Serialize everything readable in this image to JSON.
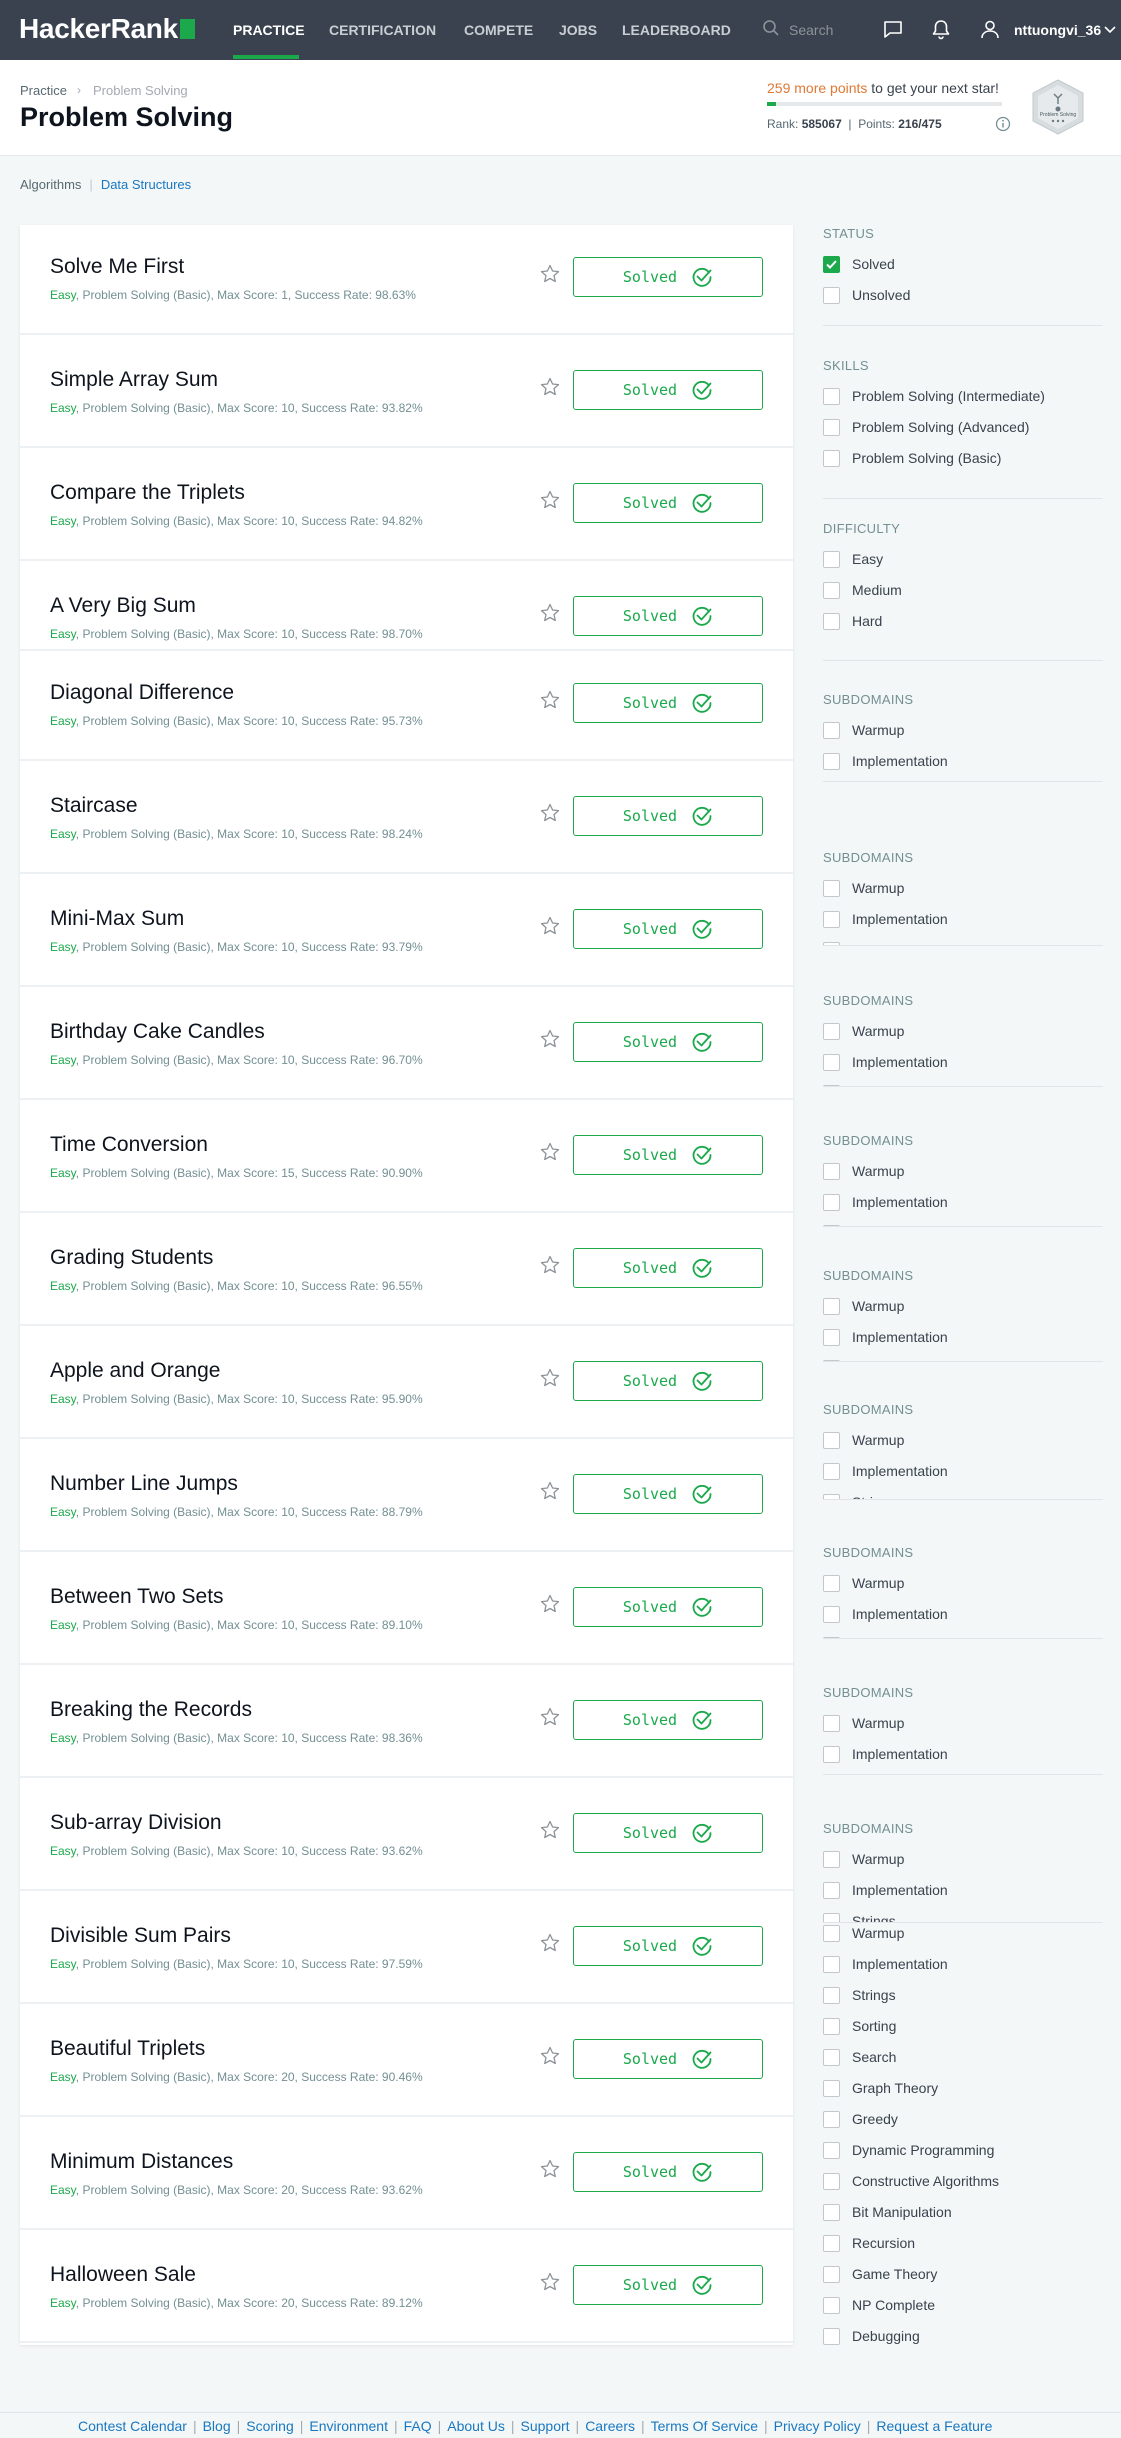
{
  "nav": {
    "logo": "HackerRank",
    "links": [
      "PRACTICE",
      "CERTIFICATION",
      "COMPETE",
      "JOBS",
      "LEADERBOARD"
    ],
    "search_placeholder": "Search",
    "username": "nttuongvi_36"
  },
  "header": {
    "breadcrumb": [
      "Practice",
      "Problem Solving"
    ],
    "title": "Problem Solving",
    "points_highlight": "259 more points",
    "points_rest": " to get your next star!",
    "progress": 0.04,
    "rank_label": "Rank:",
    "rank_value": "585067",
    "points_label": "Points:",
    "points_value": "216/475",
    "badge_label": "Problem Solving"
  },
  "subnav": {
    "items": [
      "Algorithms",
      "Data Structures"
    ]
  },
  "challenges": [
    {
      "title": "Solve Me First",
      "difficulty": "Easy",
      "meta": ", Problem Solving (Basic), Max Score: 1, Success Rate: 98.63%",
      "status": "Solved"
    },
    {
      "title": "Simple Array Sum",
      "difficulty": "Easy",
      "meta": ", Problem Solving (Basic), Max Score: 10, Success Rate: 93.82%",
      "status": "Solved"
    },
    {
      "title": "Compare the Triplets",
      "difficulty": "Easy",
      "meta": ", Problem Solving (Basic), Max Score: 10, Success Rate: 94.82%",
      "status": "Solved"
    },
    {
      "title": "A Very Big Sum",
      "difficulty": "Easy",
      "meta": ", Problem Solving (Basic), Max Score: 10, Success Rate: 98.70%",
      "status": "Solved"
    },
    {
      "title": "Diagonal Difference",
      "difficulty": "Easy",
      "meta": ", Problem Solving (Basic), Max Score: 10, Success Rate: 95.73%",
      "status": "Solved"
    },
    {
      "title": "Staircase",
      "difficulty": "Easy",
      "meta": ", Problem Solving (Basic), Max Score: 10, Success Rate: 98.24%",
      "status": "Solved"
    },
    {
      "title": "Mini-Max Sum",
      "difficulty": "Easy",
      "meta": ", Problem Solving (Basic), Max Score: 10, Success Rate: 93.79%",
      "status": "Solved"
    },
    {
      "title": "Birthday Cake Candles",
      "difficulty": "Easy",
      "meta": ", Problem Solving (Basic), Max Score: 10, Success Rate: 96.70%",
      "status": "Solved"
    },
    {
      "title": "Time Conversion",
      "difficulty": "Easy",
      "meta": ", Problem Solving (Basic), Max Score: 15, Success Rate: 90.90%",
      "status": "Solved"
    },
    {
      "title": "Grading Students",
      "difficulty": "Easy",
      "meta": ", Problem Solving (Basic), Max Score: 10, Success Rate: 96.55%",
      "status": "Solved"
    },
    {
      "title": "Apple and Orange",
      "difficulty": "Easy",
      "meta": ", Problem Solving (Basic), Max Score: 10, Success Rate: 95.90%",
      "status": "Solved"
    },
    {
      "title": "Number Line Jumps",
      "difficulty": "Easy",
      "meta": ", Problem Solving (Basic), Max Score: 10, Success Rate: 88.79%",
      "status": "Solved"
    },
    {
      "title": "Between Two Sets",
      "difficulty": "Easy",
      "meta": ", Problem Solving (Basic), Max Score: 10, Success Rate: 89.10%",
      "status": "Solved"
    },
    {
      "title": "Breaking the Records",
      "difficulty": "Easy",
      "meta": ", Problem Solving (Basic), Max Score: 10, Success Rate: 98.36%",
      "status": "Solved"
    },
    {
      "title": "Sub-array Division",
      "difficulty": "Easy",
      "meta": ", Problem Solving (Basic), Max Score: 10, Success Rate: 93.62%",
      "status": "Solved"
    },
    {
      "title": "Divisible Sum Pairs",
      "difficulty": "Easy",
      "meta": ", Problem Solving (Basic), Max Score: 10, Success Rate: 97.59%",
      "status": "Solved"
    },
    {
      "title": "Beautiful Triplets",
      "difficulty": "Easy",
      "meta": ", Problem Solving (Basic), Max Score: 20, Success Rate: 90.46%",
      "status": "Solved"
    },
    {
      "title": "Minimum Distances",
      "difficulty": "Easy",
      "meta": ", Problem Solving (Basic), Max Score: 20, Success Rate: 93.62%",
      "status": "Solved"
    },
    {
      "title": "Halloween Sale",
      "difficulty": "Easy",
      "meta": ", Problem Solving (Basic), Max Score: 20, Success Rate: 89.12%",
      "status": "Solved"
    }
  ],
  "filters": {
    "status": {
      "heading": "STATUS",
      "items": [
        "Solved",
        "Unsolved"
      ],
      "checked": [
        true,
        false
      ]
    },
    "skills": {
      "heading": "SKILLS",
      "items": [
        "Problem Solving (Intermediate)",
        "Problem Solving (Advanced)",
        "Problem Solving (Basic)"
      ]
    },
    "difficulty": {
      "heading": "DIFFICULTY",
      "items": [
        "Easy",
        "Medium",
        "Hard"
      ]
    },
    "subdomains_heading": "SUBDOMAINS",
    "subdomains_partial": [
      "Warmup",
      "Implementation",
      "Strings"
    ],
    "subdomains_full": [
      "Warmup",
      "Implementation",
      "Strings",
      "Sorting",
      "Search",
      "Graph Theory",
      "Greedy",
      "Dynamic Programming",
      "Constructive Algorithms",
      "Bit Manipulation",
      "Recursion",
      "Game Theory",
      "NP Complete",
      "Debugging"
    ]
  },
  "footer": {
    "links": [
      "Contest Calendar",
      "Blog",
      "Scoring",
      "Environment",
      "FAQ",
      "About Us",
      "Support",
      "Careers",
      "Terms Of Service",
      "Privacy Policy",
      "Request a Feature"
    ]
  },
  "colors": {
    "nav_bg": "#39424e",
    "accent": "#1ba94c",
    "link": "#1a78c2",
    "points": "#e07935"
  }
}
